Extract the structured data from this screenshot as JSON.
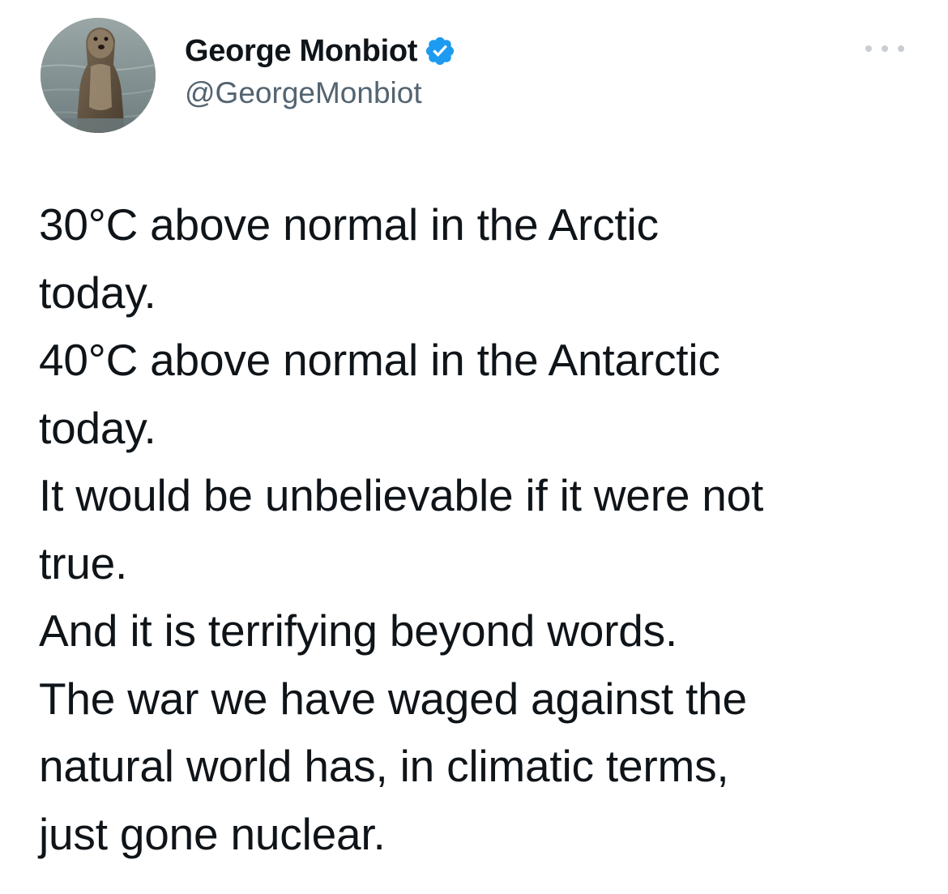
{
  "author": {
    "display_name": "George Monbiot",
    "handle": "@GeorgeMonbiot",
    "verified": true,
    "avatar_icon": "otter-avatar",
    "verified_icon": "verified-badge-icon"
  },
  "actions": {
    "more_icon": "more-options-icon"
  },
  "tweet": {
    "lines": [
      "30°C above normal in the Arctic",
      "today.",
      "40°C above normal in the Antarctic",
      "today.",
      "It would be unbelievable if it were not",
      "true.",
      "And it is terrifying beyond words.",
      "The war we have waged against the",
      "natural world has, in climatic terms,",
      "just gone nuclear."
    ]
  },
  "colors": {
    "text": "#0f1419",
    "secondary_text": "#536471",
    "verified_blue": "#1d9bf0",
    "more_dots": "#c8ced3",
    "background": "#ffffff"
  }
}
